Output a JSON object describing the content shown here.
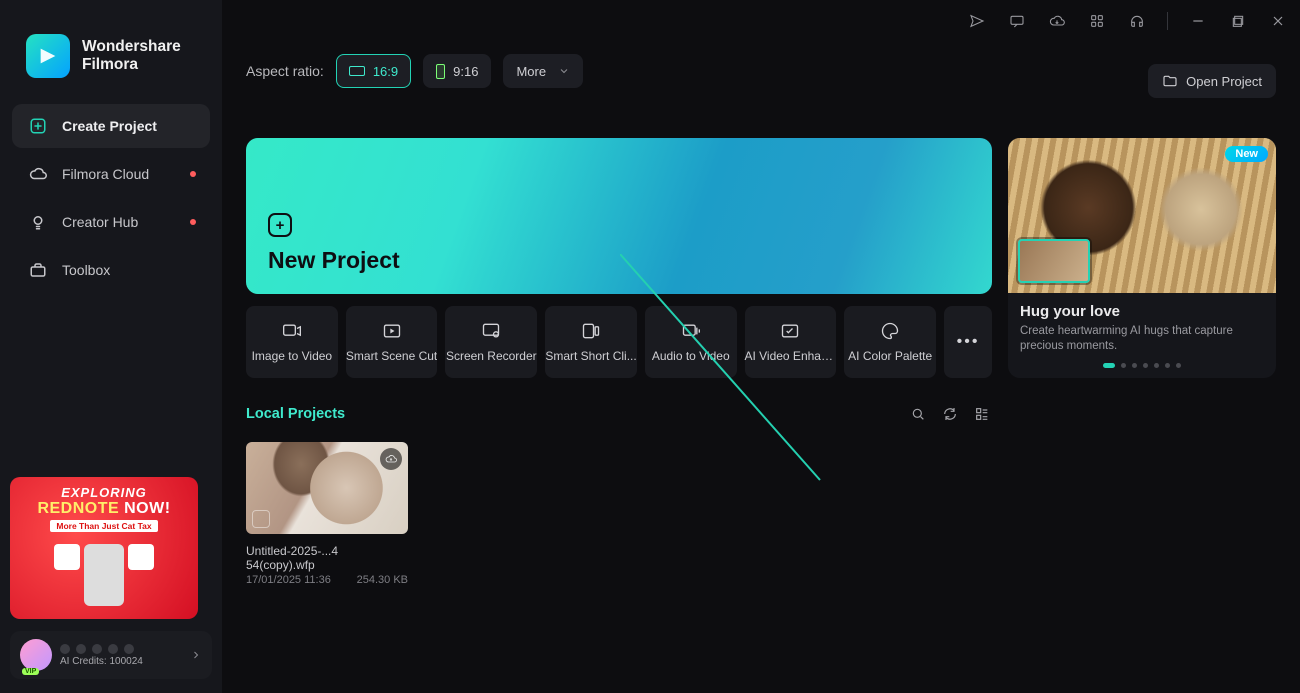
{
  "logo": {
    "line1": "Wondershare",
    "line2": "Filmora"
  },
  "sidebar": {
    "items": [
      {
        "label": "Create Project"
      },
      {
        "label": "Filmora Cloud"
      },
      {
        "label": "Creator Hub"
      },
      {
        "label": "Toolbox"
      }
    ],
    "promo": {
      "line1": "EXPLORING",
      "line2a": "REDNOTE",
      "line2b": "NOW!",
      "line3": "More Than Just Cat Tax"
    },
    "user": {
      "vip": "VIP",
      "credits": "AI Credits: 100024"
    }
  },
  "aspect": {
    "label": "Aspect ratio:",
    "r169": "16:9",
    "r916": "9:16",
    "more": "More"
  },
  "open_project": "Open Project",
  "hero": {
    "title": "New Project"
  },
  "tiles": {
    "items": [
      {
        "label": "Image to Video"
      },
      {
        "label": "Smart Scene Cut"
      },
      {
        "label": "Screen Recorder"
      },
      {
        "label": "Smart Short Cli..."
      },
      {
        "label": "Audio to Video"
      },
      {
        "label": "AI Video Enhan..."
      },
      {
        "label": "AI Color Palette"
      }
    ]
  },
  "local": {
    "title": "Local Projects"
  },
  "projects": [
    {
      "name": "Untitled-2025-...4 54(copy).wfp",
      "date": "17/01/2025 11:36",
      "size": "254.30 KB"
    }
  ],
  "sidecard": {
    "badge": "New",
    "title": "Hug your love",
    "desc": "Create heartwarming AI hugs that capture precious moments."
  }
}
